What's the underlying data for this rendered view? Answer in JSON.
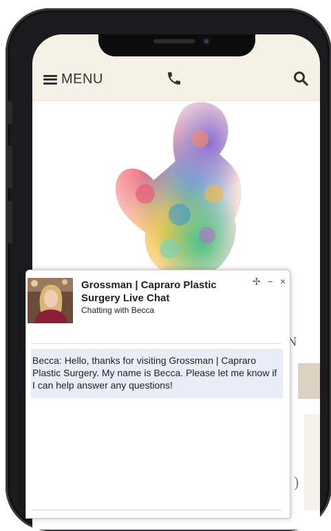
{
  "header": {
    "menu_label": "MENU",
    "phone_icon": "phone-icon",
    "search_icon": "search-icon"
  },
  "side": {
    "partial_letter": "N",
    "partial_letter_2": ")"
  },
  "chat": {
    "title": "Grossman | Capraro Plastic Surgery Live Chat",
    "subtitle": "Chatting with Becca",
    "controls": [
      "move-icon",
      "minimize-icon",
      "close-icon"
    ],
    "controls_glyphs": {
      "move": "✢",
      "minimize": "−",
      "close": "×"
    },
    "message": "Becca: Hello, thanks for visiting Grossman | Capraro Plastic Surgery. My name is Becca. Please let me know if I can help answer any questions!"
  },
  "colors": {
    "topbar_bg": "#f6f1e6",
    "message_bg": "#e8edf8",
    "phone_frame": "#1b1b1d"
  }
}
